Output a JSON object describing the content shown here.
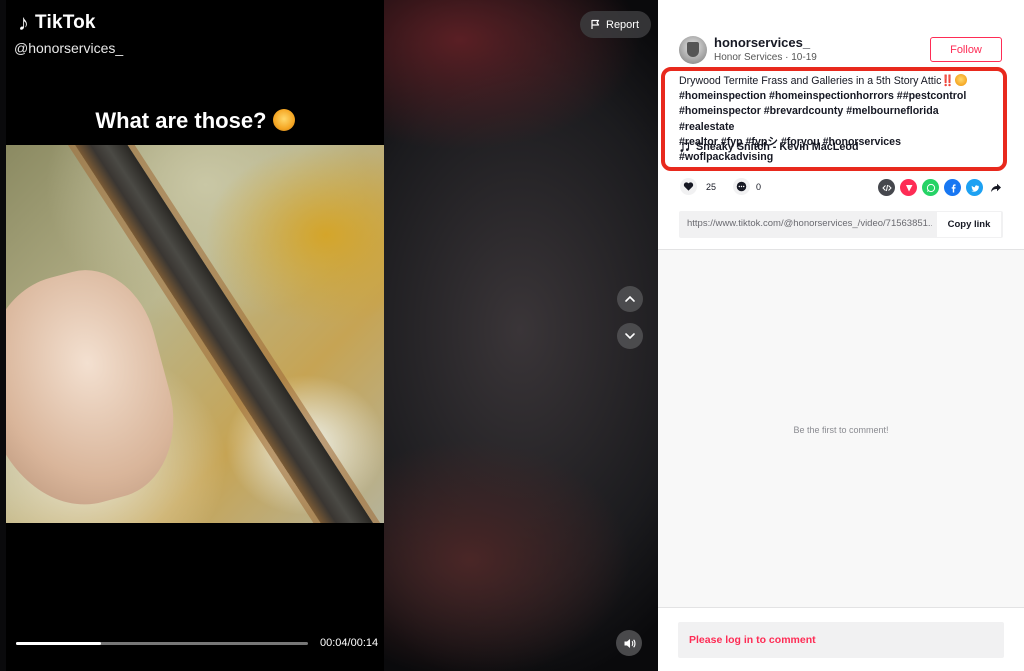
{
  "brand": {
    "logo_label": "TikTok",
    "handle": "@honorservices_"
  },
  "video": {
    "overlay_caption": "What are those?",
    "time": "00:04/00:14",
    "progress": 0.29,
    "report_label": "Report"
  },
  "author": {
    "username": "honorservices_",
    "nickname_date": "Honor Services · 10-19",
    "follow_label": "Follow"
  },
  "description": {
    "title": "Drywood Termite Frass and Galleries in a 5th Story Attic",
    "exclaim": "‼️",
    "hashtags_line1": "#homeinspection #homeinspectionhorrors ##pestcontrol",
    "hashtags_line2": "#homeinspector #brevardcounty #melbourneflorida #realestate",
    "hashtags_line3": "#realtor #fyp #fypシ #foryou #honorservices #woflpackadvising",
    "music": "Sneaky Snitch - Kevin MacLeod"
  },
  "actions": {
    "like_count": "25",
    "comment_count": "0",
    "share_icons": [
      "embed-icon",
      "send-icon",
      "whatsapp-icon",
      "facebook-icon",
      "twitter-icon",
      "share-arrow-icon"
    ]
  },
  "copy_link": {
    "url": "https://www.tiktok.com/@honorservices_/video/71563851...",
    "button_label": "Copy link"
  },
  "comments": {
    "empty_text": "Be the first to comment!",
    "login_prompt": "Please log in to comment"
  },
  "colors": {
    "accent": "#fe2c55",
    "highlight_box": "#e8291d",
    "whatsapp": "#25d366",
    "facebook": "#1877f2",
    "twitter": "#1da1f2"
  }
}
